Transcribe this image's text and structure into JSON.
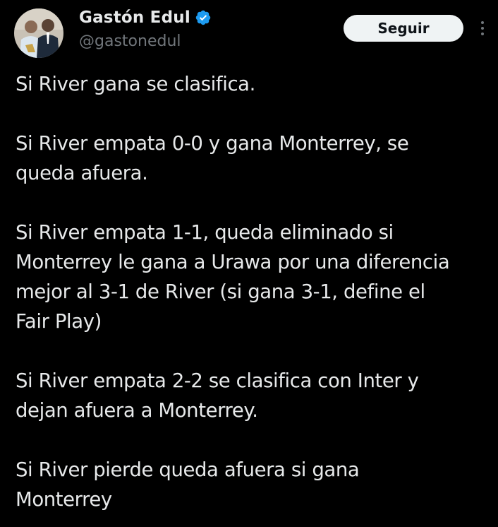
{
  "author": {
    "display_name": "Gastón Edul",
    "handle": "@gastonedul",
    "verified_icon": "verified-badge-icon",
    "verified_color": "#1d9bf0"
  },
  "actions": {
    "follow_label": "Seguir",
    "more_icon": "more-options-icon"
  },
  "tweet": {
    "paragraphs": [
      "Si River gana se clasifica.",
      "Si River empata 0-0 y gana Monterrey, se\nqueda afuera.",
      "Si River empata 1-1, queda eliminado si\nMonterrey le gana a Urawa por una diferencia\nmejor al 3-1 de River (si gana 3-1, define el\nFair Play)",
      "Si River empata 2-2 se clasifica con Inter y\ndejan afuera a Monterrey.",
      "Si River pierde queda afuera si gana\nMonterrey"
    ]
  },
  "colors": {
    "background": "#000000",
    "text_primary": "#e7e9ea",
    "text_secondary": "#71767b",
    "button_bg": "#eff3f4",
    "button_text": "#0f1419"
  }
}
